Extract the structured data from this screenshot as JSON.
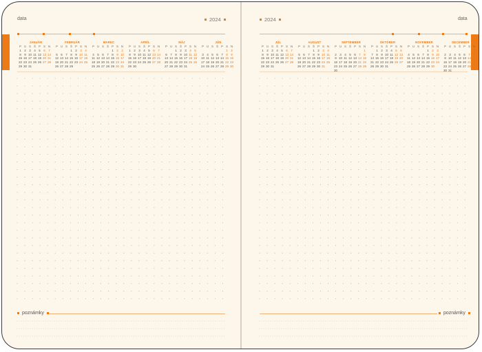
{
  "left_page": {
    "header_label": "data",
    "year": "2024",
    "footer_label": "poznámky",
    "months": [
      {
        "name": "JANUÁR",
        "start": 1,
        "days": 31
      },
      {
        "name": "FEBRUÁR",
        "start": 4,
        "days": 29
      },
      {
        "name": "MAREC",
        "start": 5,
        "days": 31
      },
      {
        "name": "APRÍL",
        "start": 1,
        "days": 30
      },
      {
        "name": "MÁJ",
        "start": 3,
        "days": 31
      },
      {
        "name": "JÚN",
        "start": 6,
        "days": 30
      }
    ]
  },
  "right_page": {
    "header_label": "data",
    "year": "2024",
    "footer_label": "poznámky",
    "months": [
      {
        "name": "JÚL",
        "start": 1,
        "days": 31
      },
      {
        "name": "AUGUST",
        "start": 4,
        "days": 31
      },
      {
        "name": "SEPTEMBER",
        "start": 7,
        "days": 30
      },
      {
        "name": "OKTÓBER",
        "start": 2,
        "days": 31
      },
      {
        "name": "NOVEMBER",
        "start": 5,
        "days": 30
      },
      {
        "name": "DECEMBER",
        "start": 7,
        "days": 31
      }
    ]
  },
  "weekday_headers": [
    "P",
    "U",
    "S",
    "Š",
    "P",
    "S",
    "N"
  ],
  "colors": {
    "accent": "#ec7a16",
    "paper": "#fdf6ea",
    "border": "#3a3a3a"
  }
}
